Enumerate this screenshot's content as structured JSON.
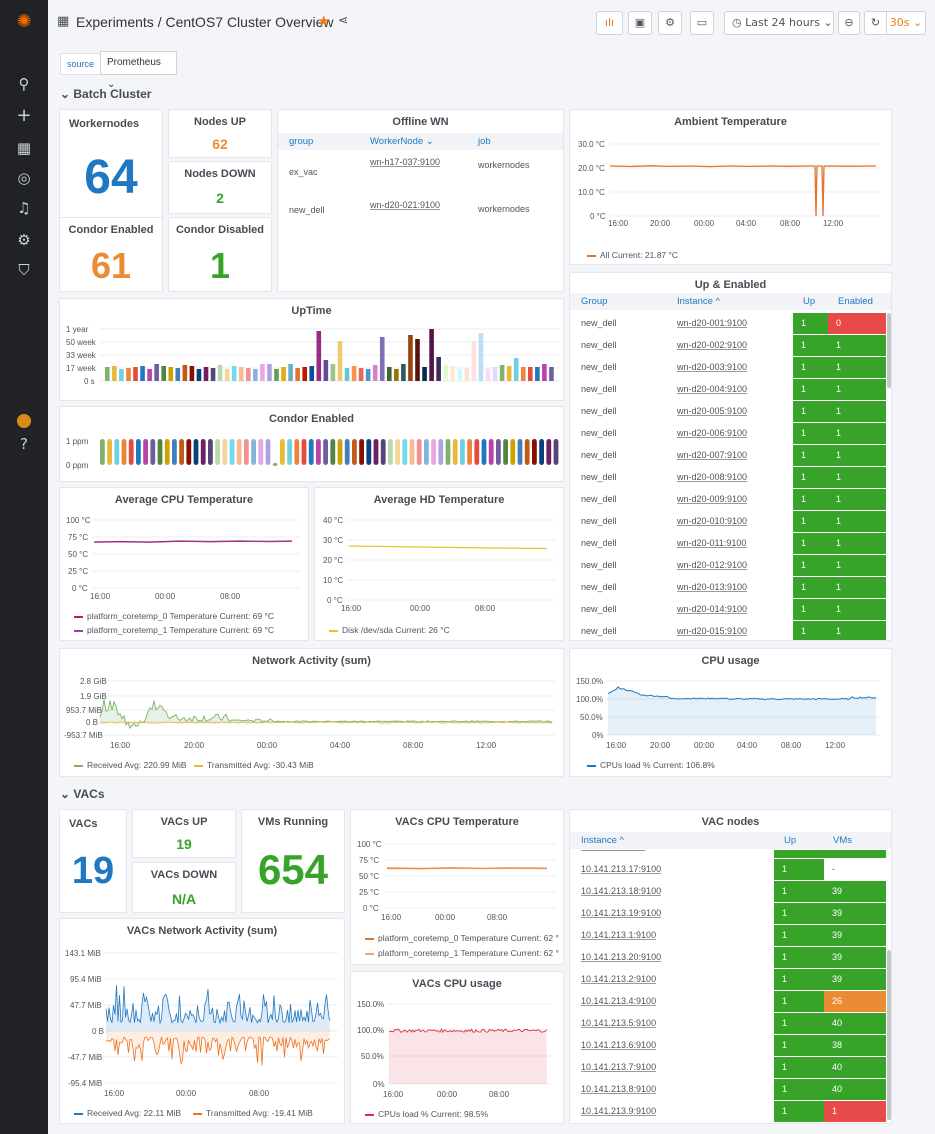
{
  "sidebar": {
    "icons": [
      "grafana-logo",
      "search-icon",
      "plus-icon",
      "dashboards-icon",
      "explore-icon",
      "alert-bell-icon",
      "gear-icon",
      "shield-icon",
      "user-avatar",
      "help-icon"
    ]
  },
  "navbar": {
    "breadcrumb": "Experiments / CentOS7 Cluster Overview",
    "time_range": "Last 24 hours",
    "refresh": "30s"
  },
  "variables": {
    "source_label": "source",
    "source_value": "Prometheus"
  },
  "rows": {
    "batch": "Batch Cluster",
    "vacs": "VACs"
  },
  "workernodes": {
    "title": "Workernodes",
    "value": "64"
  },
  "nodes_up": {
    "title": "Nodes UP",
    "value": "62"
  },
  "nodes_down": {
    "title": "Nodes DOWN",
    "value": "2"
  },
  "condor_enabled_stat": {
    "title": "Condor Enabled",
    "value": "61"
  },
  "condor_disabled_stat": {
    "title": "Condor Disabled",
    "value": "1"
  },
  "offline_wn": {
    "title": "Offline WN",
    "headers": [
      "group",
      "WorkerNode",
      "job"
    ],
    "rows": [
      {
        "group": "ex_vac",
        "node": "wn-h17-037:9100",
        "job": "workernodes"
      },
      {
        "group": "new_dell",
        "node": "wn-d20-021:9100",
        "job": "workernodes"
      }
    ]
  },
  "ambient": {
    "title": "Ambient Temperature",
    "yticks": [
      "30.0 °C",
      "20.0 °C",
      "10.0 °C",
      "0 °C"
    ],
    "xticks": [
      "16:00",
      "20:00",
      "00:00",
      "04:00",
      "08:00",
      "12:00"
    ],
    "legend": "All  Current: 21.87 °C"
  },
  "up_enabled": {
    "title": "Up & Enabled",
    "headers": [
      "Group",
      "Instance",
      "Up",
      "Enabled"
    ],
    "rows": [
      {
        "group": "new_dell",
        "instance": "wn-d20-001:9100",
        "up": "1",
        "enabled": "0"
      },
      {
        "group": "new_dell",
        "instance": "wn-d20-002:9100",
        "up": "1",
        "enabled": "1"
      },
      {
        "group": "new_dell",
        "instance": "wn-d20-003:9100",
        "up": "1",
        "enabled": "1"
      },
      {
        "group": "new_dell",
        "instance": "wn-d20-004:9100",
        "up": "1",
        "enabled": "1"
      },
      {
        "group": "new_dell",
        "instance": "wn-d20-005:9100",
        "up": "1",
        "enabled": "1"
      },
      {
        "group": "new_dell",
        "instance": "wn-d20-006:9100",
        "up": "1",
        "enabled": "1"
      },
      {
        "group": "new_dell",
        "instance": "wn-d20-007:9100",
        "up": "1",
        "enabled": "1"
      },
      {
        "group": "new_dell",
        "instance": "wn-d20-008:9100",
        "up": "1",
        "enabled": "1"
      },
      {
        "group": "new_dell",
        "instance": "wn-d20-009:9100",
        "up": "1",
        "enabled": "1"
      },
      {
        "group": "new_dell",
        "instance": "wn-d20-010:9100",
        "up": "1",
        "enabled": "1"
      },
      {
        "group": "new_dell",
        "instance": "wn-d20-011:9100",
        "up": "1",
        "enabled": "1"
      },
      {
        "group": "new_dell",
        "instance": "wn-d20-012:9100",
        "up": "1",
        "enabled": "1"
      },
      {
        "group": "new_dell",
        "instance": "wn-d20-013:9100",
        "up": "1",
        "enabled": "1"
      },
      {
        "group": "new_dell",
        "instance": "wn-d20-014:9100",
        "up": "1",
        "enabled": "1"
      },
      {
        "group": "new_dell",
        "instance": "wn-d20-015:9100",
        "up": "1",
        "enabled": "1"
      }
    ]
  },
  "uptime": {
    "title": "UpTime",
    "yticks": [
      "1 year",
      "50 week",
      "33 week",
      "17 week",
      "0 s"
    ]
  },
  "condor_enabled_chart": {
    "title": "Condor Enabled",
    "yticks": [
      "1 ppm",
      "0 ppm"
    ]
  },
  "avg_cpu_temp": {
    "title": "Average CPU Temperature",
    "yticks": [
      "100 °C",
      "75 °C",
      "50 °C",
      "25 °C",
      "0 °C"
    ],
    "xticks": [
      "16:00",
      "00:00",
      "08:00"
    ],
    "legend": [
      "platform_coretemp_0 Temperature  Current: 69 °C",
      "platform_coretemp_1 Temperature  Current: 69 °C"
    ]
  },
  "avg_hd_temp": {
    "title": "Average HD Temperature",
    "yticks": [
      "40 °C",
      "30 °C",
      "20 °C",
      "10 °C",
      "0 °C"
    ],
    "xticks": [
      "16:00",
      "00:00",
      "08:00"
    ],
    "legend": "Disk /dev/sda  Current: 26 °C"
  },
  "network": {
    "title": "Network Activity (sum)",
    "yticks": [
      "2.8 GiB",
      "1.9 GiB",
      "953.7 MiB",
      "0 B",
      "-953.7 MiB"
    ],
    "xticks": [
      "16:00",
      "20:00",
      "00:00",
      "04:00",
      "08:00",
      "12:00"
    ],
    "legend": [
      "Received  Avg: 220.99 MiB",
      "Transmitted  Avg: -30.43 MiB"
    ]
  },
  "cpu_usage": {
    "title": "CPU usage",
    "yticks": [
      "150.0%",
      "100.0%",
      "50.0%",
      "0%"
    ],
    "xticks": [
      "16:00",
      "20:00",
      "00:00",
      "04:00",
      "08:00",
      "12:00"
    ],
    "legend": "CPUs load %  Current: 106.8%"
  },
  "vacs": {
    "title": "VACs",
    "value": "19"
  },
  "vacs_up": {
    "title": "VACs UP",
    "value": "19"
  },
  "vacs_down": {
    "title": "VACs DOWN",
    "value": "N/A"
  },
  "vms_running": {
    "title": "VMs Running",
    "value": "654"
  },
  "vacs_cpu_temp": {
    "title": "VACs CPU Temperature",
    "yticks": [
      "100 °C",
      "75 °C",
      "50 °C",
      "25 °C",
      "0 °C"
    ],
    "xticks": [
      "16:00",
      "00:00",
      "08:00"
    ],
    "legend": [
      "platform_coretemp_0 Temperature  Current: 62 °",
      "platform_coretemp_1 Temperature  Current: 62 °"
    ]
  },
  "vacs_network": {
    "title": "VACs Network Activity (sum)",
    "yticks": [
      "143.1 MiB",
      "95.4 MiB",
      "47.7 MiB",
      "0 B",
      "-47.7 MiB",
      "-95.4 MiB"
    ],
    "xticks": [
      "16:00",
      "00:00",
      "08:00"
    ],
    "legend": [
      "Received  Avg: 22.11 MiB",
      "Transmitted  Avg: -19.41 MiB"
    ]
  },
  "vacs_cpu_usage": {
    "title": "VACs CPU usage",
    "yticks": [
      "150.0%",
      "100.0%",
      "50.0%",
      "0%"
    ],
    "xticks": [
      "16:00",
      "00:00",
      "08:00"
    ],
    "legend": "CPUs load %  Current: 98.5%"
  },
  "vac_nodes": {
    "title": "VAC nodes",
    "headers": [
      "Instance",
      "Up",
      "VMs"
    ],
    "rows": [
      {
        "instance": "10.141.213.17:9100",
        "up": "1",
        "vms": "-"
      },
      {
        "instance": "10.141.213.18:9100",
        "up": "1",
        "vms": "39"
      },
      {
        "instance": "10.141.213.19:9100",
        "up": "1",
        "vms": "39"
      },
      {
        "instance": "10.141.213.1:9100",
        "up": "1",
        "vms": "39"
      },
      {
        "instance": "10.141.213.20:9100",
        "up": "1",
        "vms": "39"
      },
      {
        "instance": "10.141.213.2:9100",
        "up": "1",
        "vms": "39"
      },
      {
        "instance": "10.141.213.4:9100",
        "up": "1",
        "vms": "26"
      },
      {
        "instance": "10.141.213.5:9100",
        "up": "1",
        "vms": "40"
      },
      {
        "instance": "10.141.213.6:9100",
        "up": "1",
        "vms": "38"
      },
      {
        "instance": "10.141.213.7:9100",
        "up": "1",
        "vms": "40"
      },
      {
        "instance": "10.141.213.8:9100",
        "up": "1",
        "vms": "40"
      },
      {
        "instance": "10.141.213.9:9100",
        "up": "1",
        "vms": "1"
      }
    ]
  },
  "colors": {
    "green": "#37a329",
    "orange": "#eb8c34",
    "red": "#e84a4a",
    "blue": "#1f78c1"
  }
}
